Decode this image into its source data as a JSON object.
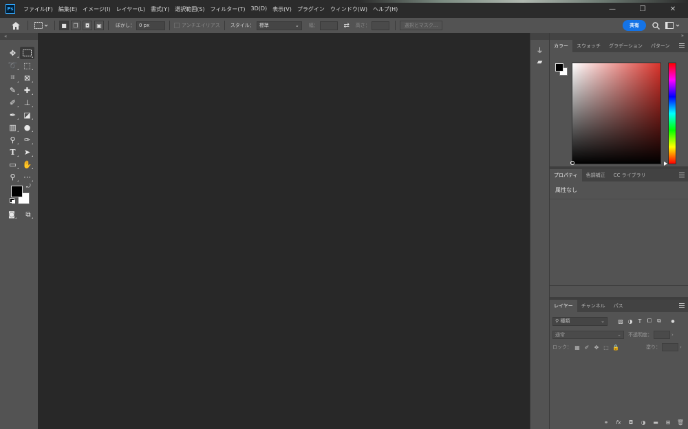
{
  "app": {
    "logo": "Ps"
  },
  "menu": {
    "items": [
      "ファイル(F)",
      "編集(E)",
      "イメージ(I)",
      "レイヤー(L)",
      "書式(Y)",
      "選択範囲(S)",
      "フィルター(T)",
      "3D(D)",
      "表示(V)",
      "プラグイン",
      "ウィンドウ(W)",
      "ヘルプ(H)"
    ]
  },
  "window": {
    "minimize": "—",
    "restore": "❐",
    "close": "✕"
  },
  "options": {
    "feather_label": "ぼかし：",
    "feather_value": "0 px",
    "antialias_label": "アンチエイリアス",
    "style_label": "スタイル：",
    "style_value": "標準",
    "width_label": "幅：",
    "height_label": "高さ：",
    "mask_button": "選択とマスク...",
    "share_button": "共有"
  },
  "panels": {
    "color_tabs": [
      "カラー",
      "スウォッチ",
      "グラデーション",
      "パターン"
    ],
    "properties_tabs": [
      "プロパティ",
      "色調補正",
      "CC ライブラリ"
    ],
    "properties_text": "属性なし",
    "layers_tabs": [
      "レイヤー",
      "チャンネル",
      "パス"
    ],
    "layers_search_placeholder": "種類",
    "blend_mode": "通常",
    "opacity_label": "不透明度：",
    "lock_label": "ロック：",
    "fill_label": "塗り："
  },
  "colors": {
    "foreground": "#000000",
    "background": "#ffffff",
    "accent": "#1473e6"
  }
}
